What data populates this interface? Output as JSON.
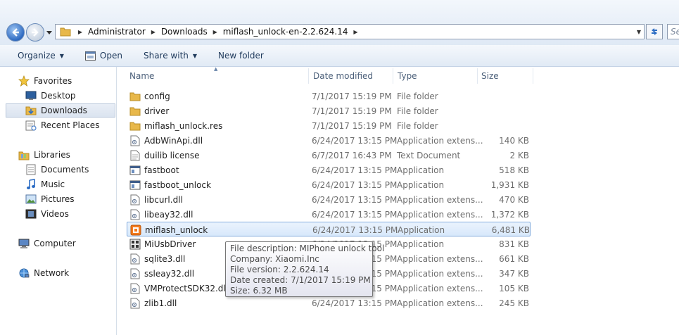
{
  "address": {
    "crumbs": [
      "Administrator",
      "Downloads",
      "miflash_unlock-en-2.2.624.14"
    ],
    "search_placeholder": "Se"
  },
  "toolbar": {
    "organize": "Organize",
    "open": "Open",
    "share_with": "Share with",
    "new_folder": "New folder"
  },
  "sidebar": {
    "favorites": "Favorites",
    "desktop": "Desktop",
    "downloads": "Downloads",
    "recent_places": "Recent Places",
    "libraries": "Libraries",
    "documents": "Documents",
    "music": "Music",
    "pictures": "Pictures",
    "videos": "Videos",
    "computer": "Computer",
    "network": "Network"
  },
  "columns": {
    "name": "Name",
    "date": "Date modified",
    "type": "Type",
    "size": "Size"
  },
  "files": [
    {
      "name": "config",
      "date": "7/1/2017 15:19 PM",
      "type": "File folder",
      "size": "",
      "icon": "folder-icon"
    },
    {
      "name": "driver",
      "date": "7/1/2017 15:19 PM",
      "type": "File folder",
      "size": "",
      "icon": "folder-icon"
    },
    {
      "name": "miflash_unlock.res",
      "date": "7/1/2017 15:19 PM",
      "type": "File folder",
      "size": "",
      "icon": "folder-icon"
    },
    {
      "name": "AdbWinApi.dll",
      "date": "6/24/2017 13:15 PM",
      "type": "Application extens...",
      "size": "140 KB",
      "icon": "dll-icon"
    },
    {
      "name": "duilib license",
      "date": "6/7/2017 16:43 PM",
      "type": "Text Document",
      "size": "2 KB",
      "icon": "text-document-icon"
    },
    {
      "name": "fastboot",
      "date": "6/24/2017 13:15 PM",
      "type": "Application",
      "size": "518 KB",
      "icon": "application-icon"
    },
    {
      "name": "fastboot_unlock",
      "date": "6/24/2017 13:15 PM",
      "type": "Application",
      "size": "1,931 KB",
      "icon": "application-icon"
    },
    {
      "name": "libcurl.dll",
      "date": "6/24/2017 13:15 PM",
      "type": "Application extens...",
      "size": "470 KB",
      "icon": "dll-icon"
    },
    {
      "name": "libeay32.dll",
      "date": "6/24/2017 13:15 PM",
      "type": "Application extens...",
      "size": "1,372 KB",
      "icon": "dll-icon"
    },
    {
      "name": "miflash_unlock",
      "date": "6/24/2017 13:15 PM",
      "type": "Application",
      "size": "6,481 KB",
      "icon": "miflash-app-icon"
    },
    {
      "name": "MiUsbDriver",
      "date": "6/24/2017 13:15 PM",
      "type": "Application",
      "size": "831 KB",
      "icon": "installer-icon"
    },
    {
      "name": "sqlite3.dll",
      "date": "6/24/2017 13:15 PM",
      "type": "Application extens...",
      "size": "661 KB",
      "icon": "dll-icon"
    },
    {
      "name": "ssleay32.dll",
      "date": "6/24/2017 13:15 PM",
      "type": "Application extens...",
      "size": "347 KB",
      "icon": "dll-icon"
    },
    {
      "name": "VMProtectSDK32.dll",
      "date": "6/24/2017 13:15 PM",
      "type": "Application extens...",
      "size": "105 KB",
      "icon": "dll-icon"
    },
    {
      "name": "zlib1.dll",
      "date": "6/24/2017 13:15 PM",
      "type": "Application extens...",
      "size": "245 KB",
      "icon": "dll-icon"
    }
  ],
  "tooltip": {
    "description": "File description: MIPhone unlock tool",
    "company": "Company: Xiaomi.Inc",
    "version": "File version: 2.2.624.14",
    "created": "Date created: 7/1/2017 15:19 PM",
    "size": "Size: 6.32 MB"
  },
  "colors": {
    "selection_border": "#84acdd",
    "folder": "#e8b84a",
    "toolbar_text": "#1e395b"
  }
}
